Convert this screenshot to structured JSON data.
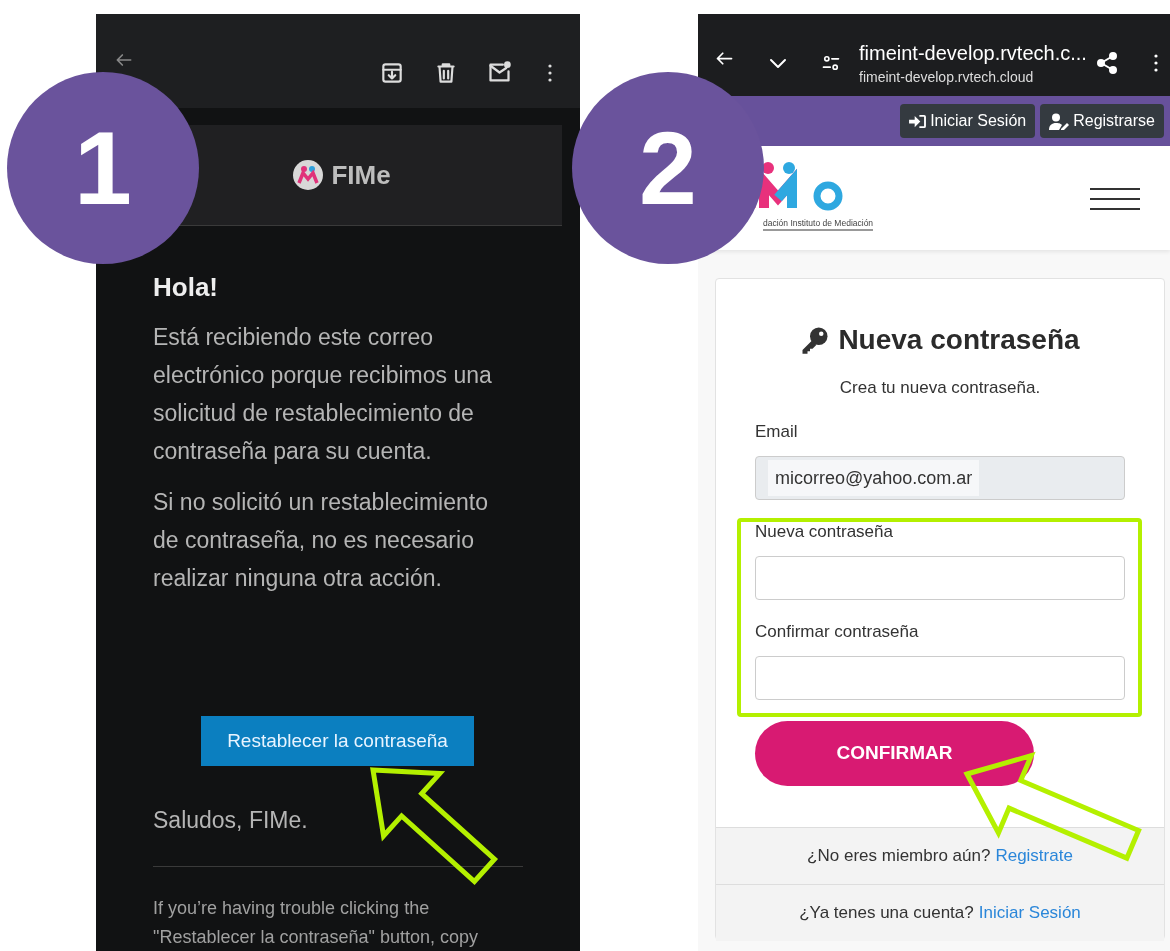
{
  "steps": [
    {
      "number": "1"
    },
    {
      "number": "2"
    }
  ],
  "email_app": {
    "brand": "FIMe",
    "greeting": "Hola!",
    "paragraphs": [
      "Está recibiendo este correo electrónico porque recibimos una solicitud de restablecimiento de contraseña para su cuenta.",
      "Si no solicitó un restablecimiento de contraseña, no es necesario realizar ninguna otra acción."
    ],
    "button": "Restablecer la contraseña",
    "signoff": "Saludos, FIMe.",
    "fallback": "If you’re having trouble clicking the \"Restablecer la contraseña\" button, copy"
  },
  "browser": {
    "title": "fimeint-develop.rvtech.c...",
    "url": "fimeint-develop.rvtech.cloud"
  },
  "site": {
    "nav_buttons": [
      {
        "kind": "login",
        "label": "Iniciar Sesión"
      },
      {
        "kind": "register",
        "label": "Registrarse"
      }
    ],
    "logo_caption": "dación Instituto de Mediación",
    "form": {
      "title": "Nueva contraseña",
      "subtitle": "Crea tu nueva contraseña.",
      "fields": [
        {
          "label": "Email",
          "value": "micorreo@yahoo.com.ar",
          "disabled": true
        },
        {
          "label": "Nueva contraseña",
          "disabled": false
        },
        {
          "label": "Confirmar contraseña",
          "disabled": false
        }
      ],
      "button": "CONFIRMAR"
    },
    "footer": [
      {
        "text": "¿No eres miembro aún?",
        "link": "Registrate"
      },
      {
        "text": "¿Ya tenes una cuenta?",
        "link": "Iniciar Sesión"
      }
    ]
  }
}
